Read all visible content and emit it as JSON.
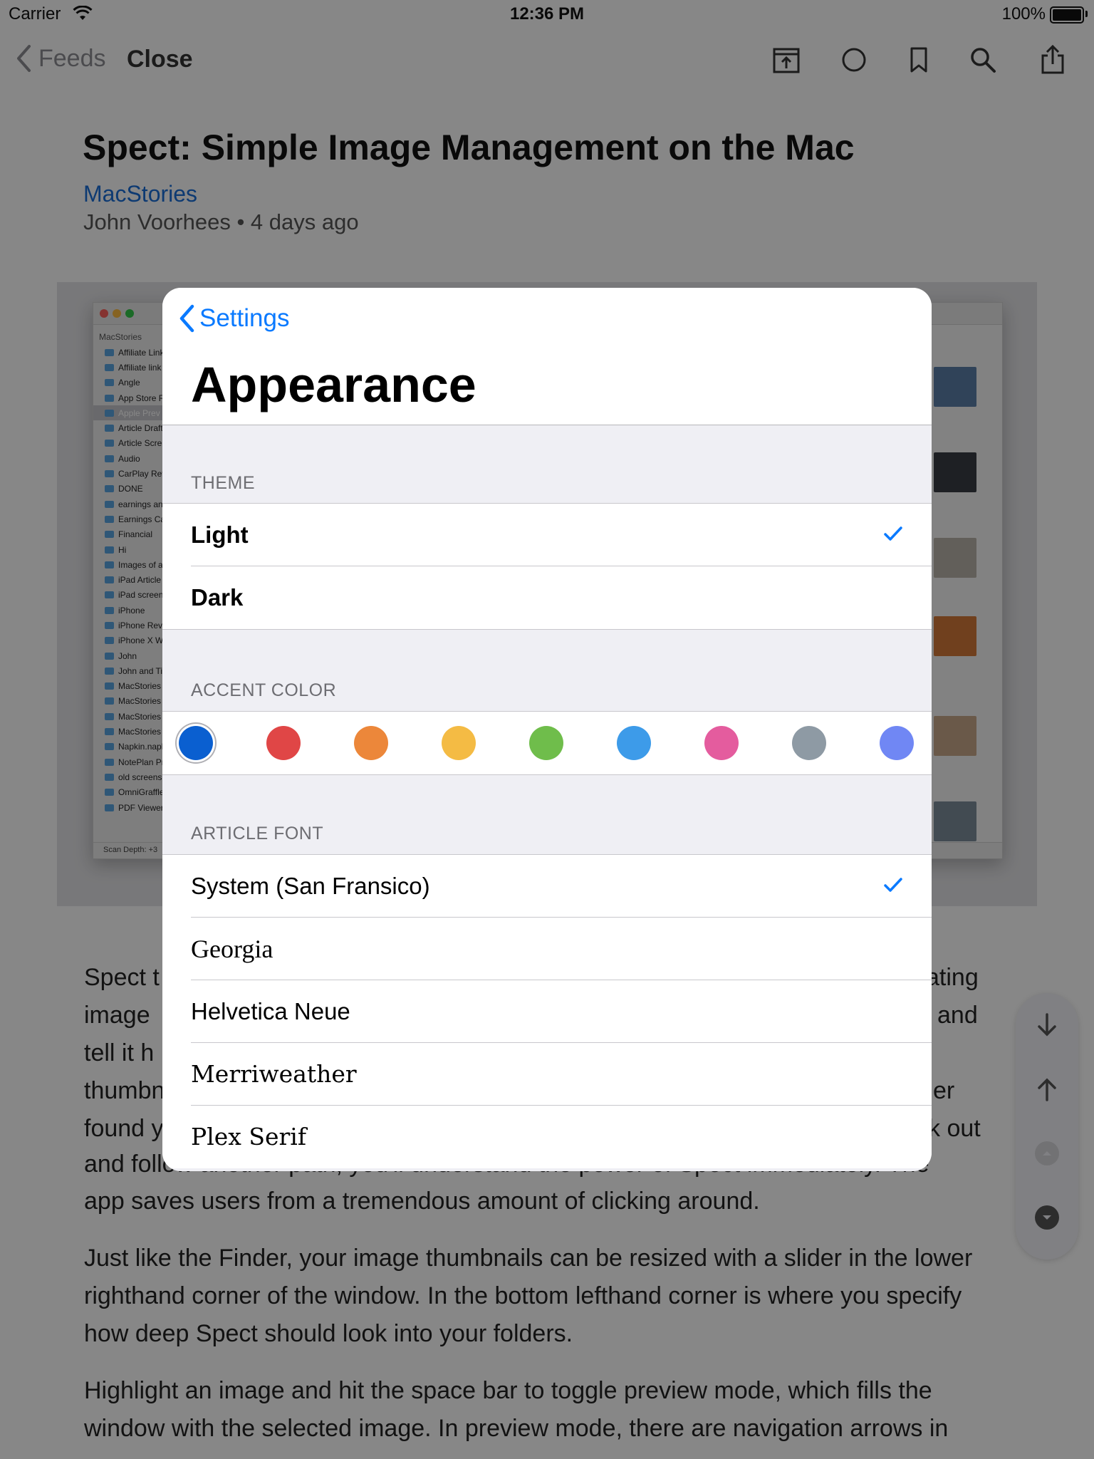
{
  "status_bar": {
    "carrier": "Carrier",
    "time": "12:36 PM",
    "battery": "100%"
  },
  "navbar": {
    "back_label": "Feeds",
    "close_label": "Close",
    "icons": [
      "open-in-app-icon",
      "read-status-icon",
      "bookmark-icon",
      "search-icon",
      "share-icon"
    ]
  },
  "article": {
    "title": "Spect: Simple Image Management on the Mac",
    "feed": "MacStories",
    "byline": "John Voorhees • 4 days ago",
    "paragraphs": [
      "Spect t",
      "image",
      "tell it h",
      "thumbn",
      "found y",
      "and follow another path, you'll understand the power of Spect immediately. The",
      "app saves users from a tremendous amount of clicking around.",
      "Just like the Finder, your image thumbnails can be resized with a slider in the lower righthand corner of the window. In the bottom lefthand corner is where you specify how deep Spect should look into your folders.",
      "Highlight an image and hit the space bar to toggle preview mode, which fills the window with the selected image. In preview mode, there are navigation arrows in"
    ],
    "right_fragments": [
      "ating",
      "and",
      "er",
      "ck out"
    ],
    "screenshot": {
      "sidebar_header": "MacStories",
      "folders": [
        "Affiliate Link",
        "Affiliate link",
        "Angle",
        "App Store R",
        "Apple Prev",
        "Article Draft",
        "Article Scre",
        "Audio",
        "CarPlay Rev",
        "DONE",
        "earnings an",
        "Earnings Ca",
        "Financial",
        "Hi",
        "Images of a",
        "iPad Article",
        "iPad screen",
        "iPhone",
        "iPhone Revi",
        "iPhone X W",
        "John",
        "John and Ti",
        "MacStories",
        "MacStories",
        "MacStories",
        "MacStories",
        "Napkin.napk",
        "NotePlan Pr",
        "old screens",
        "OmniGraffle",
        "PDF Viewer"
      ],
      "footer": "Scan Depth: +3"
    }
  },
  "popover": {
    "back_label": "Settings",
    "title": "Appearance",
    "theme": {
      "label": "THEME",
      "options": [
        {
          "label": "Light",
          "selected": true
        },
        {
          "label": "Dark",
          "selected": false
        }
      ]
    },
    "accent": {
      "label": "ACCENT COLOR",
      "colors": [
        "#0a5fd0",
        "#e04646",
        "#ec873a",
        "#f4bb44",
        "#6fbd4b",
        "#3d9be9",
        "#e45c9e",
        "#8e9aa4",
        "#7087f4"
      ],
      "selected_index": 0
    },
    "font": {
      "label": "ARTICLE FONT",
      "options": [
        {
          "label": "System (San Fransico)",
          "selected": true
        },
        {
          "label": "Georgia",
          "selected": false
        },
        {
          "label": "Helvetica Neue",
          "selected": false
        },
        {
          "label": "Merriweather",
          "selected": false
        },
        {
          "label": "Plex Serif",
          "selected": false
        }
      ]
    }
  },
  "colors": {
    "accent": "#0a7aff",
    "link": "#1a6fd8"
  }
}
